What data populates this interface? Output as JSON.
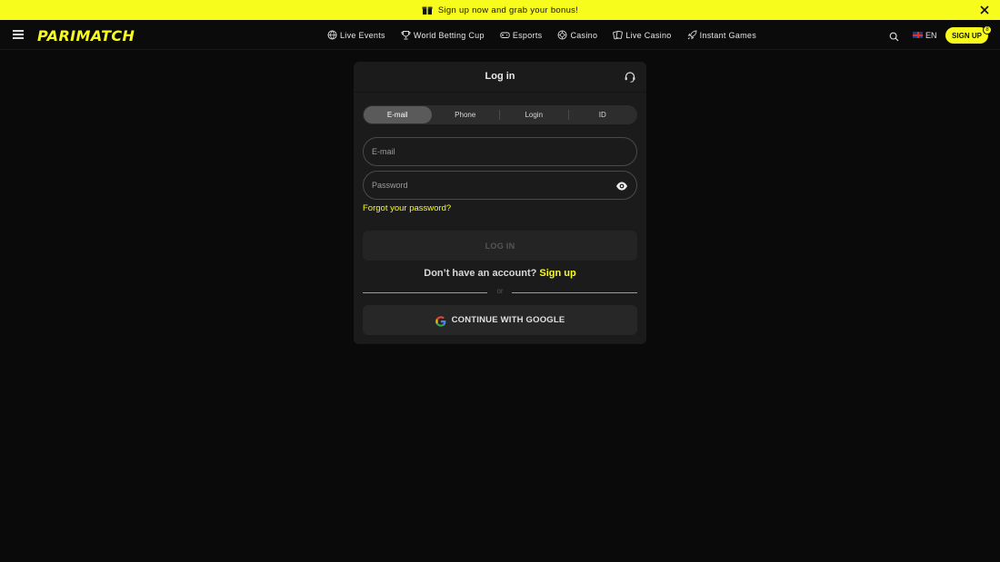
{
  "promo": {
    "text": "Sign up now and grab your bonus!",
    "icon": "gift-icon"
  },
  "header": {
    "logo": "PARIMATCH",
    "nav": [
      {
        "label": "Live Events",
        "icon": "globe-icon"
      },
      {
        "label": "World Betting Cup",
        "icon": "trophy-icon"
      },
      {
        "label": "Esports",
        "icon": "gamepad-icon"
      },
      {
        "label": "Casino",
        "icon": "chip-icon"
      },
      {
        "label": "Live Casino",
        "icon": "cards-icon"
      },
      {
        "label": "Instant Games",
        "icon": "rocket-icon"
      }
    ],
    "language": "EN",
    "signup_label": "SIGN UP",
    "signup_badge": "8"
  },
  "modal": {
    "title": "Log in",
    "tabs": [
      {
        "label": "E-mail",
        "active": true
      },
      {
        "label": "Phone",
        "active": false
      },
      {
        "label": "Login",
        "active": false
      },
      {
        "label": "ID",
        "active": false
      }
    ],
    "email_placeholder": "E-mail",
    "password_placeholder": "Password",
    "forgot_label": "Forgot your password?",
    "login_label": "LOG IN",
    "account_prompt": "Don’t have an account?",
    "signup_link": "Sign up",
    "or_label": "or",
    "google_label": "CONTINUE WITH GOOGLE"
  },
  "colors": {
    "accent": "#f8fc1c",
    "background": "#0a0a0a",
    "panel": "#1b1b1b"
  }
}
